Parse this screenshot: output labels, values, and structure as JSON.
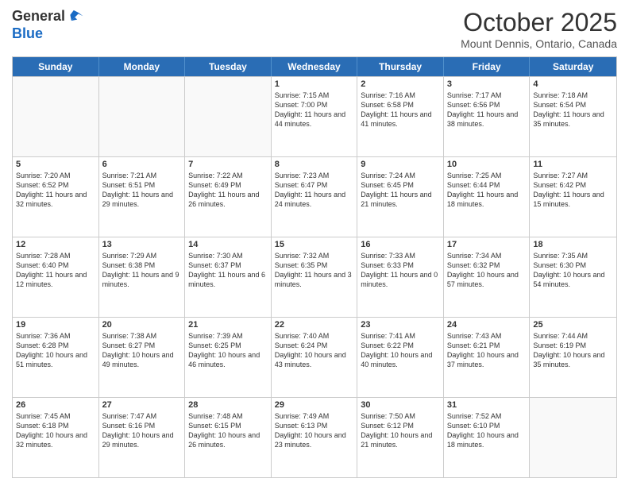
{
  "header": {
    "logo_line1": "General",
    "logo_line2": "Blue",
    "month": "October 2025",
    "location": "Mount Dennis, Ontario, Canada"
  },
  "weekdays": [
    "Sunday",
    "Monday",
    "Tuesday",
    "Wednesday",
    "Thursday",
    "Friday",
    "Saturday"
  ],
  "rows": [
    [
      {
        "day": "",
        "info": ""
      },
      {
        "day": "",
        "info": ""
      },
      {
        "day": "",
        "info": ""
      },
      {
        "day": "1",
        "info": "Sunrise: 7:15 AM\nSunset: 7:00 PM\nDaylight: 11 hours and 44 minutes."
      },
      {
        "day": "2",
        "info": "Sunrise: 7:16 AM\nSunset: 6:58 PM\nDaylight: 11 hours and 41 minutes."
      },
      {
        "day": "3",
        "info": "Sunrise: 7:17 AM\nSunset: 6:56 PM\nDaylight: 11 hours and 38 minutes."
      },
      {
        "day": "4",
        "info": "Sunrise: 7:18 AM\nSunset: 6:54 PM\nDaylight: 11 hours and 35 minutes."
      }
    ],
    [
      {
        "day": "5",
        "info": "Sunrise: 7:20 AM\nSunset: 6:52 PM\nDaylight: 11 hours and 32 minutes."
      },
      {
        "day": "6",
        "info": "Sunrise: 7:21 AM\nSunset: 6:51 PM\nDaylight: 11 hours and 29 minutes."
      },
      {
        "day": "7",
        "info": "Sunrise: 7:22 AM\nSunset: 6:49 PM\nDaylight: 11 hours and 26 minutes."
      },
      {
        "day": "8",
        "info": "Sunrise: 7:23 AM\nSunset: 6:47 PM\nDaylight: 11 hours and 24 minutes."
      },
      {
        "day": "9",
        "info": "Sunrise: 7:24 AM\nSunset: 6:45 PM\nDaylight: 11 hours and 21 minutes."
      },
      {
        "day": "10",
        "info": "Sunrise: 7:25 AM\nSunset: 6:44 PM\nDaylight: 11 hours and 18 minutes."
      },
      {
        "day": "11",
        "info": "Sunrise: 7:27 AM\nSunset: 6:42 PM\nDaylight: 11 hours and 15 minutes."
      }
    ],
    [
      {
        "day": "12",
        "info": "Sunrise: 7:28 AM\nSunset: 6:40 PM\nDaylight: 11 hours and 12 minutes."
      },
      {
        "day": "13",
        "info": "Sunrise: 7:29 AM\nSunset: 6:38 PM\nDaylight: 11 hours and 9 minutes."
      },
      {
        "day": "14",
        "info": "Sunrise: 7:30 AM\nSunset: 6:37 PM\nDaylight: 11 hours and 6 minutes."
      },
      {
        "day": "15",
        "info": "Sunrise: 7:32 AM\nSunset: 6:35 PM\nDaylight: 11 hours and 3 minutes."
      },
      {
        "day": "16",
        "info": "Sunrise: 7:33 AM\nSunset: 6:33 PM\nDaylight: 11 hours and 0 minutes."
      },
      {
        "day": "17",
        "info": "Sunrise: 7:34 AM\nSunset: 6:32 PM\nDaylight: 10 hours and 57 minutes."
      },
      {
        "day": "18",
        "info": "Sunrise: 7:35 AM\nSunset: 6:30 PM\nDaylight: 10 hours and 54 minutes."
      }
    ],
    [
      {
        "day": "19",
        "info": "Sunrise: 7:36 AM\nSunset: 6:28 PM\nDaylight: 10 hours and 51 minutes."
      },
      {
        "day": "20",
        "info": "Sunrise: 7:38 AM\nSunset: 6:27 PM\nDaylight: 10 hours and 49 minutes."
      },
      {
        "day": "21",
        "info": "Sunrise: 7:39 AM\nSunset: 6:25 PM\nDaylight: 10 hours and 46 minutes."
      },
      {
        "day": "22",
        "info": "Sunrise: 7:40 AM\nSunset: 6:24 PM\nDaylight: 10 hours and 43 minutes."
      },
      {
        "day": "23",
        "info": "Sunrise: 7:41 AM\nSunset: 6:22 PM\nDaylight: 10 hours and 40 minutes."
      },
      {
        "day": "24",
        "info": "Sunrise: 7:43 AM\nSunset: 6:21 PM\nDaylight: 10 hours and 37 minutes."
      },
      {
        "day": "25",
        "info": "Sunrise: 7:44 AM\nSunset: 6:19 PM\nDaylight: 10 hours and 35 minutes."
      }
    ],
    [
      {
        "day": "26",
        "info": "Sunrise: 7:45 AM\nSunset: 6:18 PM\nDaylight: 10 hours and 32 minutes."
      },
      {
        "day": "27",
        "info": "Sunrise: 7:47 AM\nSunset: 6:16 PM\nDaylight: 10 hours and 29 minutes."
      },
      {
        "day": "28",
        "info": "Sunrise: 7:48 AM\nSunset: 6:15 PM\nDaylight: 10 hours and 26 minutes."
      },
      {
        "day": "29",
        "info": "Sunrise: 7:49 AM\nSunset: 6:13 PM\nDaylight: 10 hours and 23 minutes."
      },
      {
        "day": "30",
        "info": "Sunrise: 7:50 AM\nSunset: 6:12 PM\nDaylight: 10 hours and 21 minutes."
      },
      {
        "day": "31",
        "info": "Sunrise: 7:52 AM\nSunset: 6:10 PM\nDaylight: 10 hours and 18 minutes."
      },
      {
        "day": "",
        "info": ""
      }
    ]
  ]
}
